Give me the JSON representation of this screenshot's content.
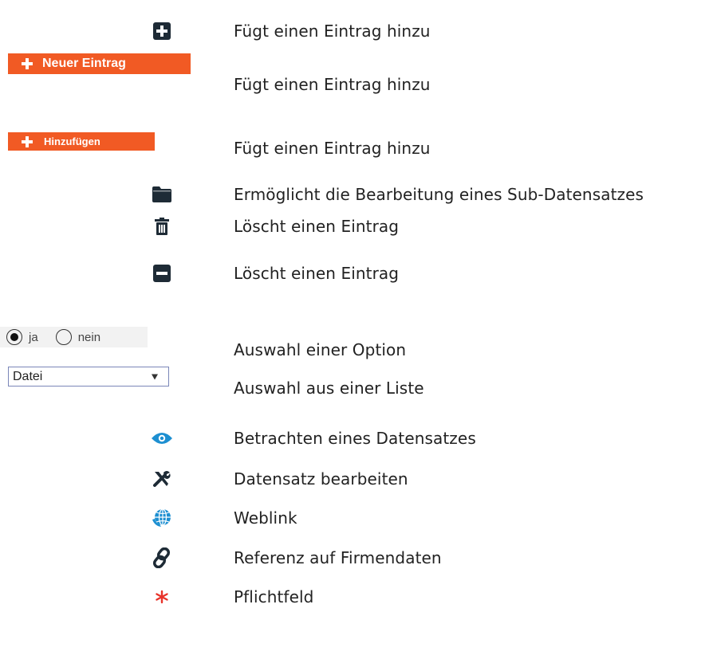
{
  "buttons": {
    "neuer_eintrag": "Neuer Eintrag",
    "hinzufuegen": "Hinzufügen"
  },
  "radio": {
    "options": [
      "ja",
      "nein"
    ],
    "selected": "ja"
  },
  "select": {
    "value": "Datei"
  },
  "rows": [
    {
      "icon": "plus-square-icon",
      "text": "Fügt einen Eintrag hinzu"
    },
    {
      "icon": "neuer-eintrag-button",
      "text": "Fügt einen Eintrag hinzu"
    },
    {
      "icon": "hinzufuegen-button",
      "text": "Fügt einen Eintrag hinzu"
    },
    {
      "icon": "folder-icon",
      "text": "Ermöglicht die Bearbeitung eines Sub-Datensatzes"
    },
    {
      "icon": "trash-icon",
      "text": "Löscht einen Eintrag"
    },
    {
      "icon": "minus-square-icon",
      "text": "Löscht einen Eintrag"
    },
    {
      "icon": "radio-group",
      "text": "Auswahl einer Option"
    },
    {
      "icon": "select-dropdown",
      "text": "Auswahl aus einer Liste"
    },
    {
      "icon": "eye-icon",
      "text": "Betrachten eines Datensatzes"
    },
    {
      "icon": "tools-icon",
      "text": "Datensatz bearbeiten"
    },
    {
      "icon": "globe-icon",
      "text": "Weblink"
    },
    {
      "icon": "link-icon",
      "text": "Referenz auf Firmendaten"
    },
    {
      "icon": "asterisk-icon",
      "text": "Pflichtfeld"
    }
  ],
  "colors": {
    "accent_orange": "#f15a24",
    "icon_dark": "#1e2b36",
    "icon_blue": "#1d8fd1",
    "required_red": "#e8332a"
  }
}
